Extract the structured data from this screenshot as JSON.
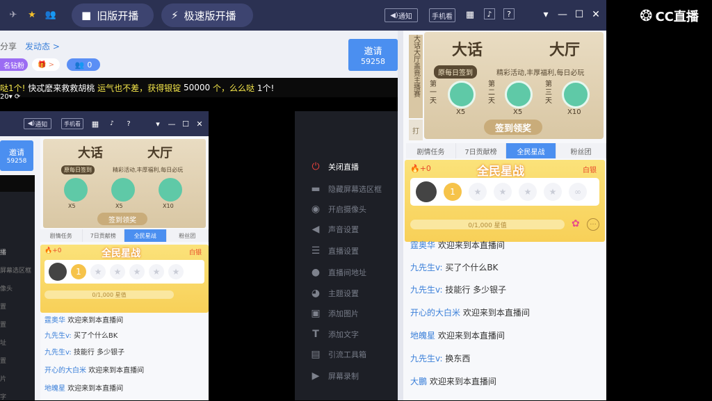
{
  "topbar": {
    "old_btn": "旧版开播",
    "fast_btn": "极速版开播",
    "notice": "通知",
    "phone": "手机看"
  },
  "brand": {
    "logo_text": "CC直播"
  },
  "left": {
    "share_text": "分享",
    "dynamic_link": "发动态 >",
    "badge": "名钻粉",
    "badge_count": "0",
    "invite_label": "邀请",
    "invite_count": "59258",
    "chat_parts": [
      "哒1个!",
      "快忒麽来救救胡桃",
      "运气也不差，获得银锭",
      "50000",
      "个，么么哒",
      "1个!"
    ],
    "small_value": "20"
  },
  "right": {
    "invite_label": "邀请",
    "invite_count": "59258",
    "banner_title_a": "大话",
    "banner_title_b": "大厅",
    "side_text_a": "大话大厅",
    "side_text_b": "盖竟主播赛",
    "daily": "原每日签到",
    "daily_desc": "精彩活动,丰厚福利,每日必玩",
    "days": [
      {
        "label": "第一天",
        "reward": "X5"
      },
      {
        "label": "第二天",
        "reward": "X5"
      },
      {
        "label": "第三天",
        "reward": "X10"
      }
    ],
    "sign_btn": "签到领奖",
    "side_small": "打",
    "tabs": [
      "剧情任务",
      "7日贡献榜",
      "全民星战",
      "粉丝团"
    ],
    "star_card": {
      "count": "+0",
      "title": "全民星战",
      "rank": "白银",
      "progress": "0/1,000 星值"
    },
    "chat": [
      {
        "name": "霆奥华",
        "msg": "欢迎来到本直播间"
      },
      {
        "name": "九先生v:",
        "msg": "买了个什么BK"
      },
      {
        "name": "九先生v:",
        "msg": "技能行 多少银子"
      },
      {
        "name": "开心的大白米",
        "msg": "欢迎来到本直播间"
      },
      {
        "name": "地魄星",
        "msg": "欢迎来到本直播间"
      },
      {
        "name": "九先生v:",
        "msg": "换东西"
      },
      {
        "name": "大鵬",
        "msg": "欢迎来到本直播间"
      }
    ]
  },
  "inner": {
    "notice": "通知",
    "phone": "手机看",
    "invite_label": "邀请",
    "invite_count": "59258",
    "chat": [
      {
        "name": "霆奥华",
        "msg": "欢迎来到本直播间"
      },
      {
        "name": "九先生v:",
        "msg": "买了个什么BK"
      },
      {
        "name": "九先生v:",
        "msg": "技能行 多少银子"
      },
      {
        "name": "开心的大白米",
        "msg": "欢迎来到本直播间"
      },
      {
        "name": "地魄星",
        "msg": "欢迎来到本直播间"
      }
    ],
    "side_labels": [
      "播",
      "屏幕选区框",
      "像头",
      "置",
      "置",
      "址",
      "置",
      "片",
      "字"
    ]
  },
  "menu": {
    "items": [
      "关闭直播",
      "隐藏屏幕选区框",
      "开启摄像头",
      "声音设置",
      "直播设置",
      "直播间地址",
      "主题设置",
      "添加图片",
      "添加文字",
      "引流工具箱",
      "屏幕录制"
    ]
  },
  "colors": {
    "accent": "#4b8ff0",
    "topbar": "#2b3152",
    "menu_bg": "#1d1f26",
    "close_live": "#e8413d"
  }
}
